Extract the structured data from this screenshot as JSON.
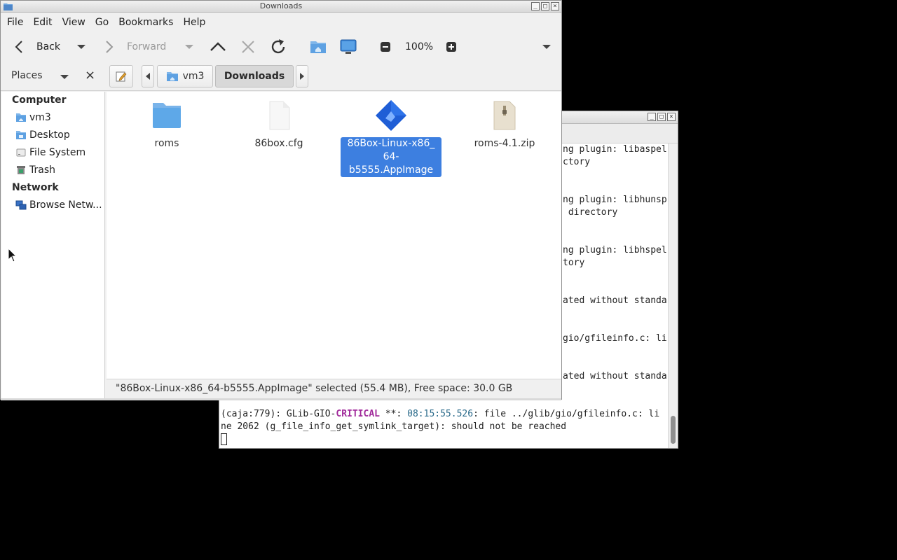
{
  "file_manager": {
    "title": "Downloads",
    "menu": [
      "File",
      "Edit",
      "View",
      "Go",
      "Bookmarks",
      "Help"
    ],
    "toolbar": {
      "back_label": "Back",
      "forward_label": "Forward",
      "zoom": "100%"
    },
    "location": {
      "places_label": "Places",
      "crumbs": [
        "vm3",
        "Downloads"
      ]
    },
    "sidebar": {
      "computer_header": "Computer",
      "computer_items": [
        "vm3",
        "Desktop",
        "File System",
        "Trash"
      ],
      "network_header": "Network",
      "network_items": [
        "Browse Netw..."
      ]
    },
    "files": [
      {
        "name": "roms",
        "type": "folder"
      },
      {
        "name": "86box.cfg",
        "type": "text-file"
      },
      {
        "name_line1": "86Box-Linux-x86_",
        "name_line2": "64-b5555.AppImage",
        "type": "appimage",
        "selected": true
      },
      {
        "name": "roms-4.1.zip",
        "type": "zip-archive"
      }
    ],
    "status": "\"86Box-Linux-x86_64-b5555.AppImage\" selected (55.4 MB), Free space: 30.0 GB"
  },
  "terminal": {
    "partial_lines": [
      "ng plugin: libaspel",
      "ctory",
      "ng plugin: libhunsp",
      " directory",
      "ng plugin: libhspel",
      "tory",
      "ated without standa",
      "gio/gfileinfo.c: li",
      "ated without standa"
    ],
    "line_a_prefix": "(caja:779): GLib-GIO-",
    "line_a_level": "CRITICAL",
    "line_a_stars": " **: ",
    "line_a_time": "08:15:55.526",
    "line_a_rest": ": file ../glib/gio/gfileinfo.c: li",
    "line_b": "ne 2062 (g_file_info_get_symlink_target): should not be reached"
  },
  "colors": {
    "selection": "#3d7fe0",
    "folder": "#5ea8e8",
    "critical": "#a0289a"
  }
}
